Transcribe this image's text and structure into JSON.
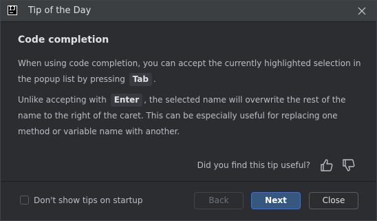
{
  "window": {
    "title": "Tip of the Day",
    "app_icon": "intellij-icon",
    "app_icon_text": "IJ"
  },
  "tip": {
    "heading": "Code completion",
    "p1_before": "When using code completion, you can accept the currently highlighted selection in the popup list by pressing",
    "p1_key": "Tab",
    "p1_after": ".",
    "p2_before": "Unlike accepting with",
    "p2_key": "Enter",
    "p2_after": ", the selected name will overwrite the rest of the name to the right of the caret. This can be especially useful for replacing one method or variable name with another."
  },
  "feedback": {
    "question": "Did you find this tip useful?",
    "like_icon": "thumbs-up-icon",
    "dislike_icon": "thumbs-down-icon"
  },
  "footer": {
    "checkbox_label": "Don't show tips on startup",
    "checkbox_checked": false,
    "back_label": "Back",
    "next_label": "Next",
    "close_label": "Close"
  },
  "colors": {
    "background": "#2b2d30",
    "titlebar": "#3c3f41",
    "primary_button": "#365880",
    "accent": "#3574f0"
  }
}
